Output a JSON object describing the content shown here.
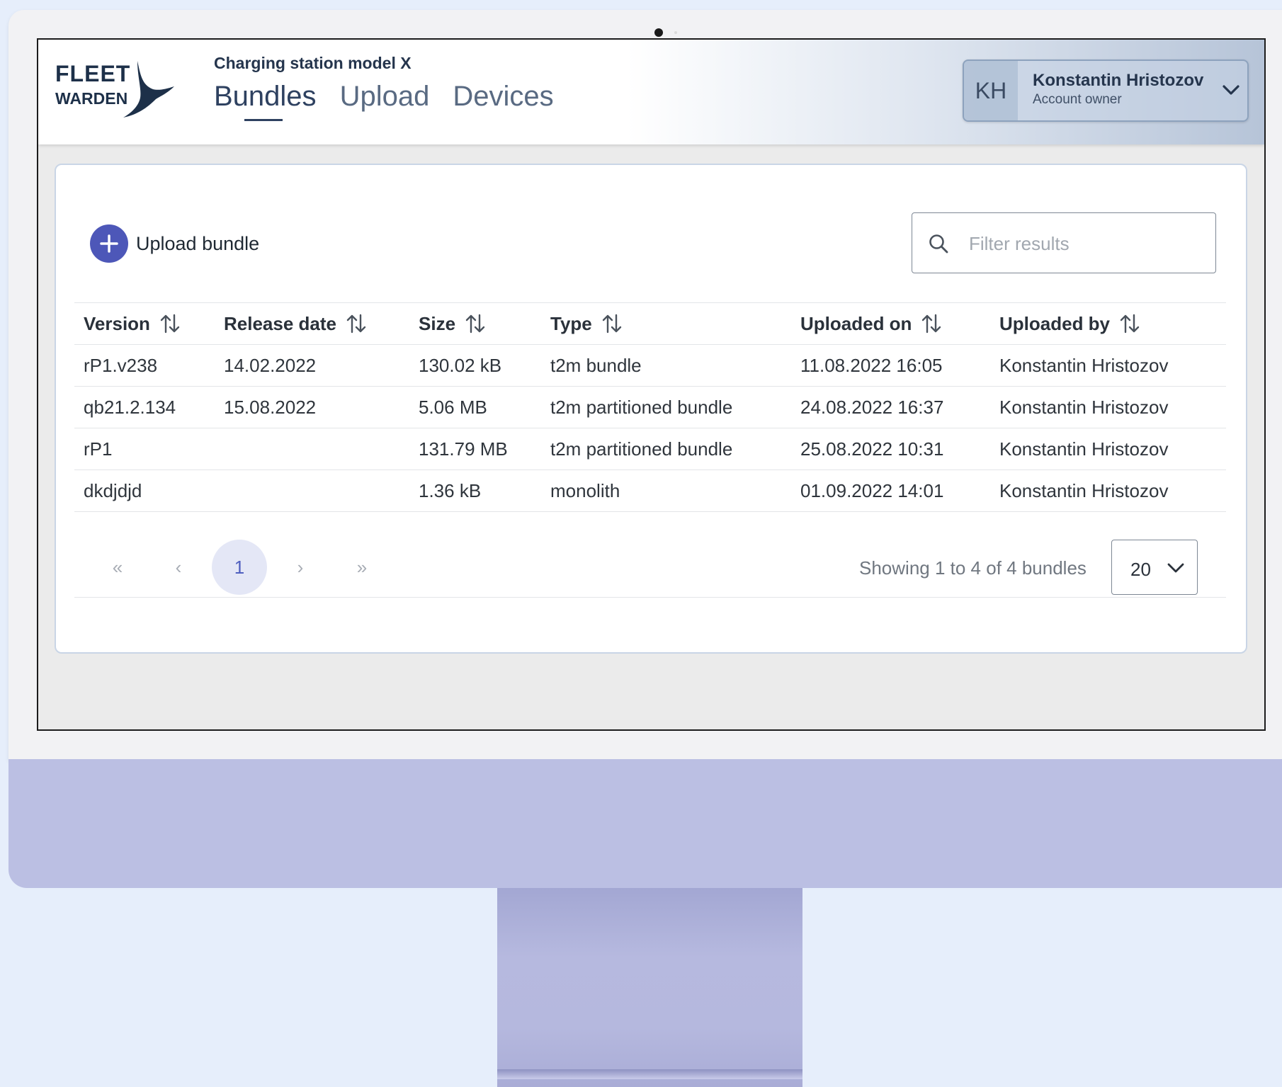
{
  "app": {
    "logo_line1": "FLEET",
    "logo_line2": "WARDEN",
    "product_name": "Charging station model X"
  },
  "nav": {
    "tabs": [
      {
        "label": "Bundles",
        "active": true
      },
      {
        "label": "Upload",
        "active": false
      },
      {
        "label": "Devices",
        "active": false
      }
    ]
  },
  "user": {
    "initials": "KH",
    "name": "Konstantin Hristozov",
    "role": "Account owner"
  },
  "toolbar": {
    "upload_label": "Upload bundle",
    "filter_placeholder": "Filter results",
    "filter_value": ""
  },
  "table": {
    "columns": [
      "Version",
      "Release date",
      "Size",
      "Type",
      "Uploaded on",
      "Uploaded by"
    ],
    "rows": [
      [
        "rP1.v238",
        "14.02.2022",
        "130.02 kB",
        "t2m bundle",
        "11.08.2022 16:05",
        "Konstantin Hristozov"
      ],
      [
        "qb21.2.134",
        "15.08.2022",
        "5.06 MB",
        "t2m partitioned bundle",
        "24.08.2022 16:37",
        "Konstantin Hristozov"
      ],
      [
        "rP1",
        "",
        "131.79 MB",
        "t2m partitioned bundle",
        "25.08.2022 10:31",
        "Konstantin Hristozov"
      ],
      [
        "dkdjdjd",
        "",
        "1.36 kB",
        "monolith",
        "01.09.2022 14:01",
        "Konstantin Hristozov"
      ]
    ]
  },
  "pagination": {
    "first": "«",
    "prev": "‹",
    "current_page": "1",
    "next": "›",
    "last": "»",
    "summary": "Showing 1 to 4 of 4 bundles",
    "page_size": "20"
  },
  "colors": {
    "brand": "#1d3049",
    "accent": "#4d57b8",
    "page_bg": "#e6eefb",
    "monitor_chin": "#bbbfe3"
  },
  "icons": {
    "logo_mark": "stingray-icon",
    "user_menu": "chevron-down-icon",
    "upload": "plus-icon",
    "filter": "search-icon",
    "sort": "sort-icon"
  }
}
